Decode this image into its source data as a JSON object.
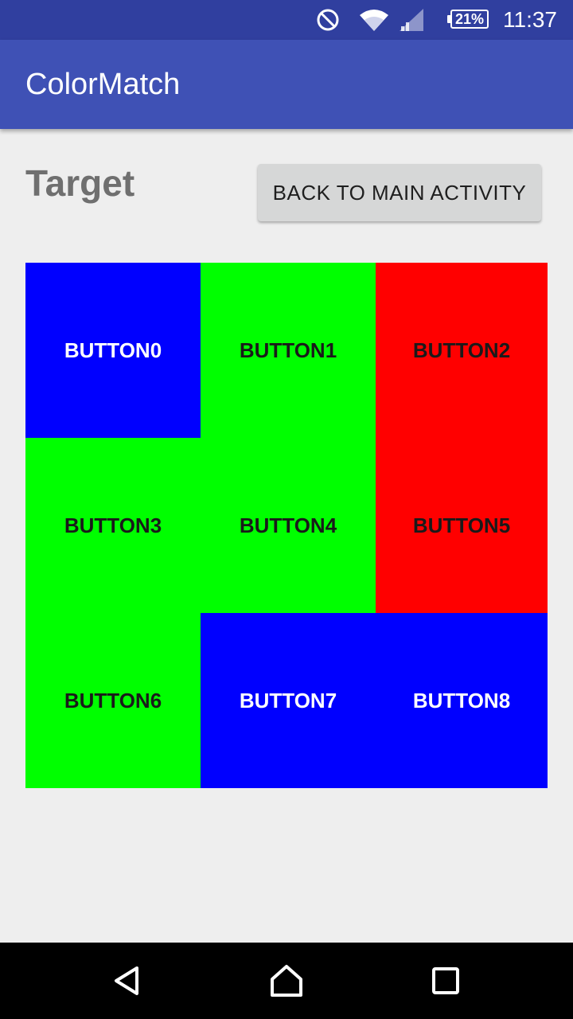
{
  "status_bar": {
    "time": "11:37",
    "battery_percent": "21%",
    "icons": [
      "do-not-disturb-icon",
      "wifi-icon",
      "cell-signal-icon",
      "battery-icon"
    ]
  },
  "app_bar": {
    "title": "ColorMatch"
  },
  "main": {
    "target_label": "Target",
    "back_button_label": "BACK TO MAIN ACTIVITY",
    "grid_buttons": [
      {
        "label": "BUTTON0",
        "color": "#0000ff",
        "text_color": "#ffffff"
      },
      {
        "label": "BUTTON1",
        "color": "#00ff00",
        "text_color": "#1a1a1a"
      },
      {
        "label": "BUTTON2",
        "color": "#ff0000",
        "text_color": "#1a1a1a"
      },
      {
        "label": "BUTTON3",
        "color": "#00ff00",
        "text_color": "#1a1a1a"
      },
      {
        "label": "BUTTON4",
        "color": "#00ff00",
        "text_color": "#1a1a1a"
      },
      {
        "label": "BUTTON5",
        "color": "#ff0000",
        "text_color": "#1a1a1a"
      },
      {
        "label": "BUTTON6",
        "color": "#00ff00",
        "text_color": "#1a1a1a"
      },
      {
        "label": "BUTTON7",
        "color": "#0000ff",
        "text_color": "#ffffff"
      },
      {
        "label": "BUTTON8",
        "color": "#0000ff",
        "text_color": "#ffffff"
      }
    ]
  },
  "nav_bar": {
    "icons": [
      "back-icon",
      "home-icon",
      "recents-icon"
    ]
  },
  "colors": {
    "primary": "#3f51b5",
    "primary_dark": "#303f9f",
    "background": "#eeeeee"
  }
}
